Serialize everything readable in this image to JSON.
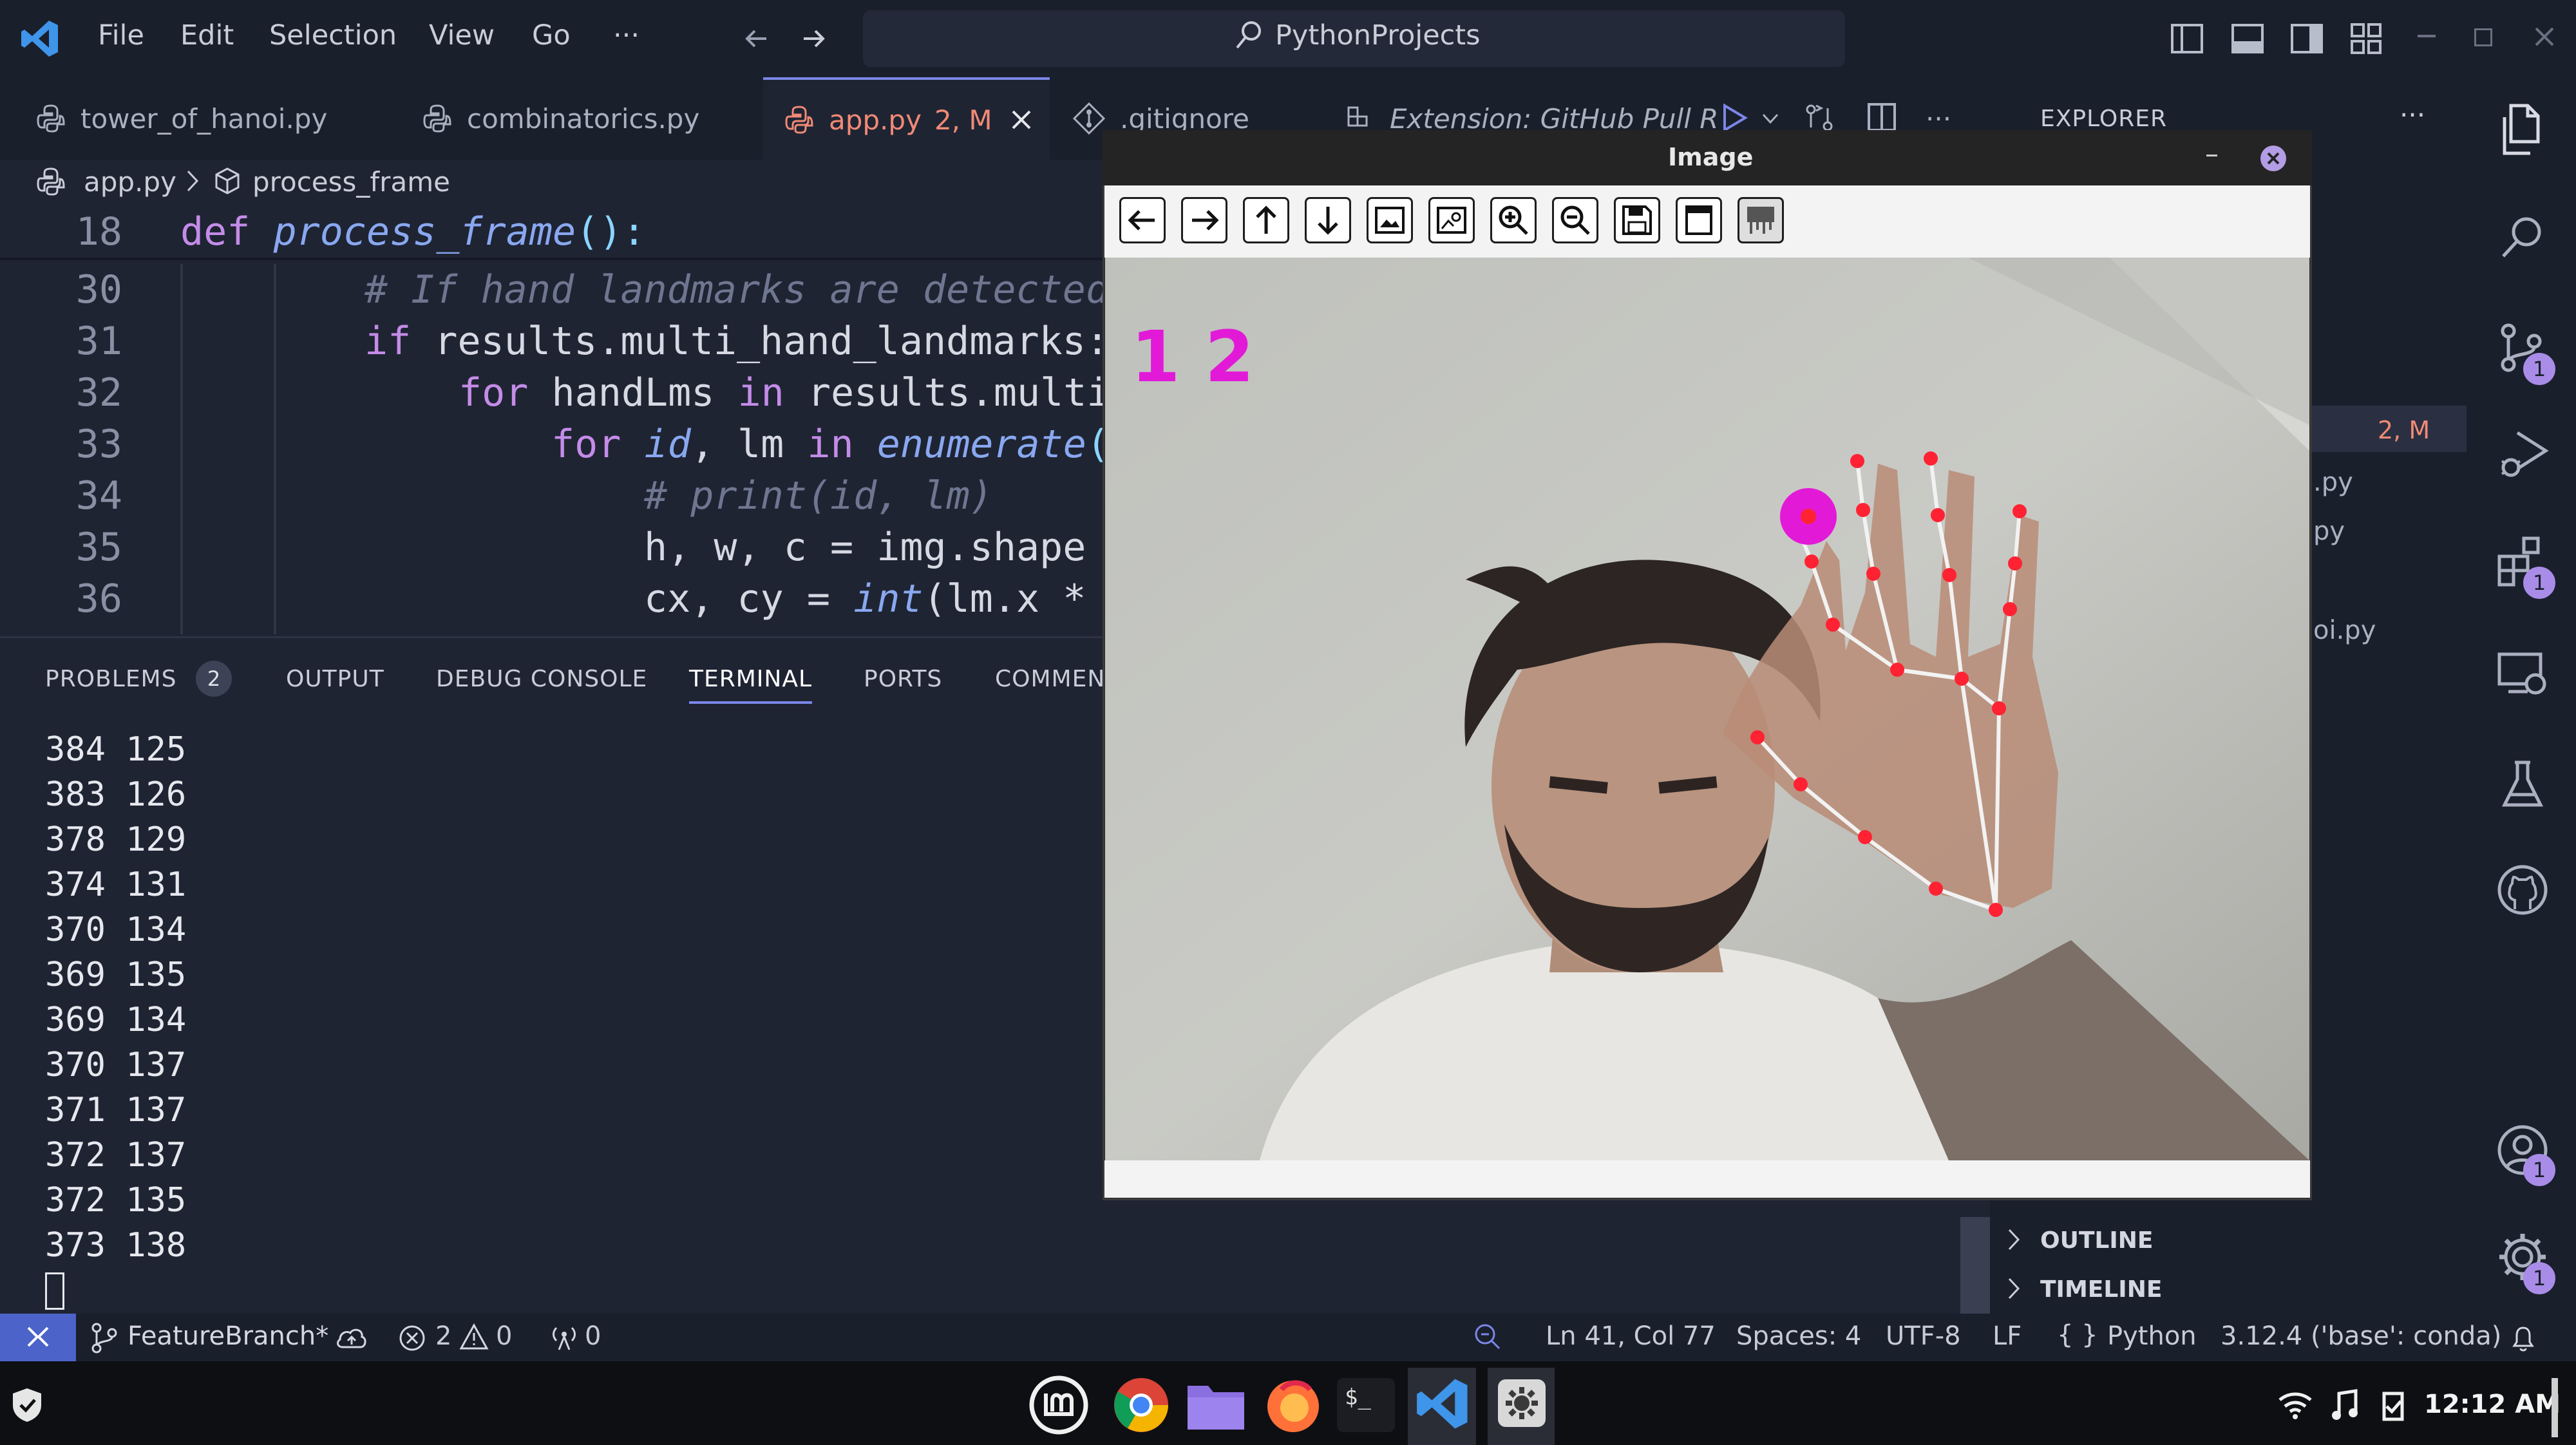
{
  "titlebar": {
    "menus": [
      "File",
      "Edit",
      "Selection",
      "View",
      "Go",
      "···"
    ],
    "search": "PythonProjects"
  },
  "tabs": [
    {
      "label": "tower_of_hanoi.py",
      "modifier": ""
    },
    {
      "label": "combinatorics.py",
      "modifier": ""
    },
    {
      "label": "app.py",
      "modifier": "2, M"
    },
    {
      "label": ".gitignore",
      "modifier": ""
    },
    {
      "label": "Extension: GitHub Pull R",
      "modifier": ""
    }
  ],
  "breadcrumb": {
    "file": "app.py",
    "symbol": "process_frame"
  },
  "editor": {
    "sticky": {
      "line": "18",
      "kw": "def",
      "fn": "process_frame",
      "rest": "():"
    },
    "lines": [
      {
        "n": "30",
        "text": "# If hand landmarks are detected"
      },
      {
        "n": "31",
        "kw": "if",
        "text": "results.multi_hand_landmarks:"
      },
      {
        "n": "32",
        "kw": "for",
        "mid": "handLms",
        "kw2": "in",
        "text": "results.multi"
      },
      {
        "n": "33",
        "kw": "for",
        "mid": "id",
        "mid2": ", lm",
        "kw2": "in",
        "fn": "enumerate",
        "text": "("
      },
      {
        "n": "34",
        "text": "# print(id, lm)"
      },
      {
        "n": "35",
        "text": "h, w, c = img.shape"
      },
      {
        "n": "36",
        "text": "cx, cy =",
        "fn": "int",
        "text2": "(lm.x *"
      }
    ]
  },
  "panel": {
    "tabs": [
      "PROBLEMS",
      "OUTPUT",
      "DEBUG CONSOLE",
      "TERMINAL",
      "PORTS",
      "COMMEN"
    ],
    "problems_count": "2",
    "terminal_lines": [
      "384 125",
      "383 126",
      "378 129",
      "374 131",
      "370 134",
      "369 135",
      "369 134",
      "370 137",
      "371 137",
      "372 137",
      "372 135",
      "373 138"
    ]
  },
  "explorer": {
    "title": "EXPLORER",
    "more": "···",
    "badge_text": "2, M",
    "items": [
      ".py",
      "py",
      "oi.py"
    ],
    "outline": "OUTLINE",
    "timeline": "TIMELINE"
  },
  "image_window": {
    "title": "Image",
    "minimize": "–",
    "finger_count": "1 2"
  },
  "statusbar": {
    "branch": "FeatureBranch*",
    "errors": "2",
    "warnings": "0",
    "ports": "0",
    "position": "Ln 41, Col 77",
    "spaces": "Spaces: 4",
    "encoding": "UTF-8",
    "eol": "LF",
    "language": "Python",
    "interpreter": "3.12.4 ('base': conda)"
  },
  "taskbar": {
    "clock": "12:12 AM"
  },
  "activity_badges": {
    "source_control": "1",
    "extensions": "1",
    "accounts": "1",
    "settings": "1"
  },
  "colors": {
    "accent": "#7c87e8",
    "modified": "#f08a76",
    "landmark": "#ff2233",
    "fingertip_marker": "#e21ad8",
    "finger_count_text": "#e21ad8"
  }
}
